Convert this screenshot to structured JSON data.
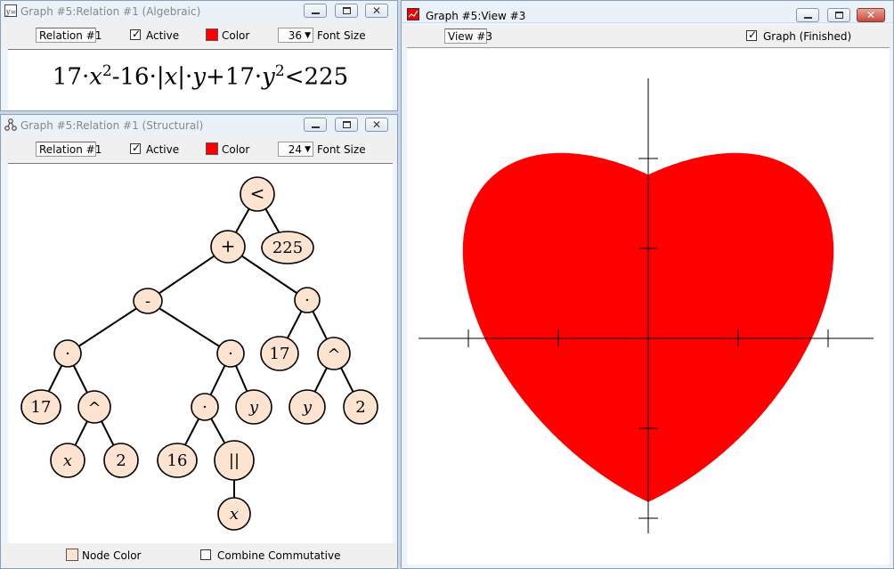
{
  "windows": {
    "algebraic": {
      "title": "Graph #5:Relation #1 (Algebraic)",
      "relation_name": "Relation #1",
      "active_label": "Active",
      "active_checked": true,
      "color_label": "Color",
      "color": "#ff0000",
      "font_size_value": "36",
      "font_size_label": "Font Size",
      "equation": {
        "c1": "17·",
        "v1": "x",
        "e1": "2",
        "op1": "-16·|",
        "v2": "x",
        "op2": "|·",
        "v3": "y",
        "op3": "+17·",
        "v4": "y",
        "e2": "2",
        "op4": "<225"
      }
    },
    "structural": {
      "title": "Graph #5:Relation #1 (Structural)",
      "relation_name": "Relation #1",
      "active_label": "Active",
      "active_checked": true,
      "color_label": "Color",
      "color": "#ff0000",
      "font_size_value": "24",
      "font_size_label": "Font Size",
      "node_color": "#fde3d0",
      "tree": {
        "n_lt": "<",
        "n_plus": "+",
        "n_225": "225",
        "n_minus": "-",
        "n_mul_right": "·",
        "n_mul_a": "·",
        "n_mul_b": "·",
        "n_17_right": "17",
        "n_pow_right": "^",
        "n_17_a": "17",
        "n_pow_a": "^",
        "n_mul_c": "·",
        "n_y_b": "y",
        "n_y_right": "y",
        "n_2_right": "2",
        "n_x_a": "x",
        "n_2_a": "2",
        "n_16": "16",
        "n_abs": "||",
        "n_x_abs": "x"
      },
      "node_color_label": "Node Color",
      "combine_label": "Combine Commutative",
      "combine_checked": false
    },
    "view": {
      "title": "Graph #5:View #3",
      "view_name": "View #3",
      "graph_label": "Graph (Finished)",
      "graph_checked": true,
      "fill_color": "#ff0000",
      "x_range": [
        -5,
        5
      ],
      "y_range": [
        -5,
        5
      ],
      "tick_step": 2
    }
  }
}
